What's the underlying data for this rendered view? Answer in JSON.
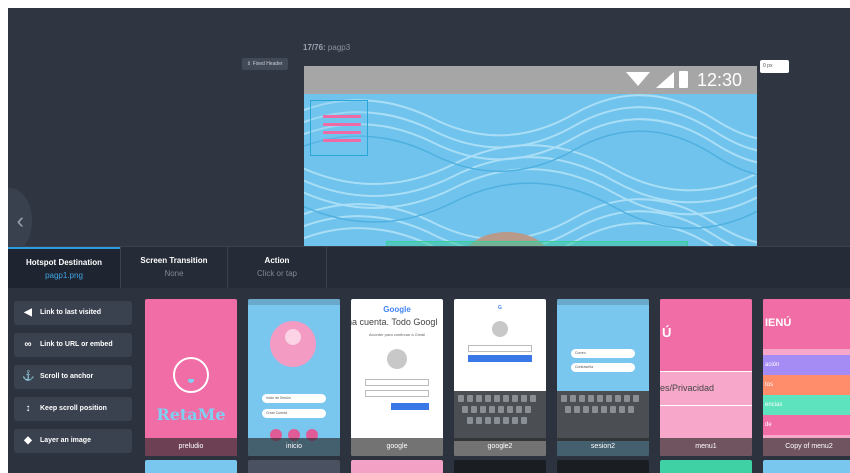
{
  "preview": {
    "counter_prefix": "17/76:",
    "counter_name": "pagp3",
    "fixed_header_label": "⇕ Fixed Header",
    "px_value": "0 px",
    "status_time": "12:30"
  },
  "tabs": [
    {
      "title": "Hotspot Destination",
      "value": "pagp1.png"
    },
    {
      "title": "Screen Transition",
      "value": "None"
    },
    {
      "title": "Action",
      "value": "Click or tap"
    }
  ],
  "actions": [
    {
      "label": "Link to last visited",
      "icon": "arrow-left-icon"
    },
    {
      "label": "Link to URL or embed",
      "icon": "link-icon"
    },
    {
      "label": "Scroll to anchor",
      "icon": "anchor-icon"
    },
    {
      "label": "Keep scroll position",
      "icon": "keep-scroll-icon"
    },
    {
      "label": "Layer an image",
      "icon": "layers-icon"
    }
  ],
  "screens": [
    {
      "label": "preludio",
      "logo_text": "RetaMe"
    },
    {
      "label": "inicio",
      "field1": "Inicio de Sesión",
      "field2": "Crear Cuenta"
    },
    {
      "label": "google",
      "logo": "Google",
      "title": "na cuenta. Todo Googl",
      "subtitle": "Acceder para continuar a Gmail"
    },
    {
      "label": "google2"
    },
    {
      "label": "sesion2",
      "field1": "Correo",
      "field2": "Contraseña"
    },
    {
      "label": "menu1",
      "heading": "Ú",
      "item": "es/Privacidad"
    },
    {
      "label": "Copy of menu2",
      "heading": "IENÚ",
      "items": [
        "ación",
        "tos",
        "encias",
        "de"
      ]
    }
  ],
  "colors": {
    "accent": "#2e9be0",
    "panel": "#2d333e",
    "pattern_blue": "#6fc3ec",
    "pink": "#f06ea5"
  }
}
